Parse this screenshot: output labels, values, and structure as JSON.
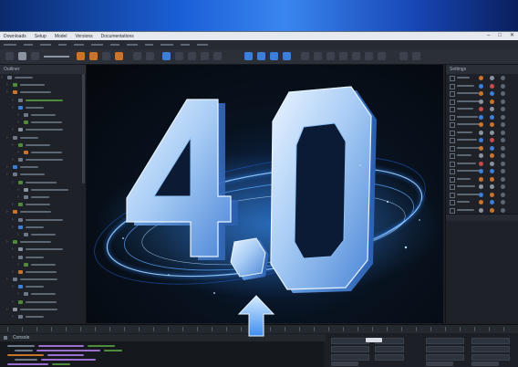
{
  "app": {
    "menu": [
      "Downloads",
      "Setup",
      "Model",
      "Versions",
      "Documentations"
    ],
    "window_controls": [
      "–",
      "□",
      "✕"
    ]
  },
  "left_panel": {
    "title": "Outliner"
  },
  "right_panel": {
    "title": "Settings"
  },
  "console": {
    "title": "Console"
  },
  "hero": {
    "version_major": "4",
    "version_separator": ".",
    "version_minor": "0"
  },
  "colors": {
    "brand_blue": "#2f7bf0",
    "glow": "#7fc4ff",
    "window_bg": "#1b1f25"
  }
}
